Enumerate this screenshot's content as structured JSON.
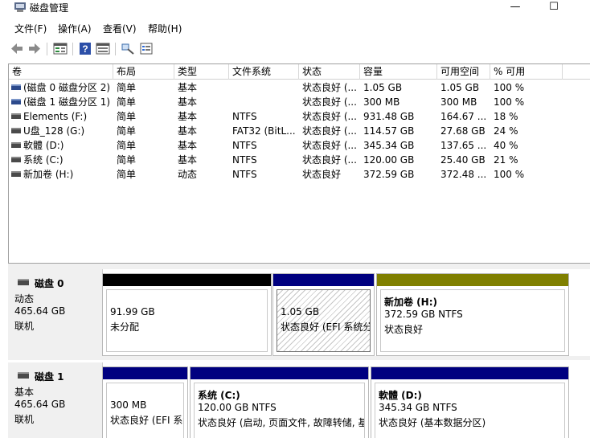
{
  "window": {
    "title": "磁盘管理",
    "minimize_glyph": "—",
    "maximize_glyph": "☐"
  },
  "menu": [
    {
      "label": "文件(F)"
    },
    {
      "label": "操作(A)"
    },
    {
      "label": "查看(V)"
    },
    {
      "label": "帮助(H)"
    }
  ],
  "toolbar": {
    "icons": [
      "back-arrow-icon",
      "forward-arrow-icon",
      "disk-list-icon",
      "help-icon",
      "properties-icon",
      "rescan-icon",
      "settings-list-icon"
    ]
  },
  "columns": [
    "卷",
    "布局",
    "类型",
    "文件系统",
    "状态",
    "容量",
    "可用空间",
    "% 可用"
  ],
  "volumes": [
    {
      "name": "(磁盘 0 磁盘分区 2)",
      "layout": "简单",
      "type": "基本",
      "fs": "",
      "status": "状态良好 (...",
      "capacity": "1.05 GB",
      "free": "1.05 GB",
      "pct": "100 %"
    },
    {
      "name": "(磁盘 1 磁盘分区 1)",
      "layout": "简单",
      "type": "基本",
      "fs": "",
      "status": "状态良好 (...",
      "capacity": "300 MB",
      "free": "300 MB",
      "pct": "100 %"
    },
    {
      "name": "Elements (F:)",
      "layout": "简单",
      "type": "基本",
      "fs": "NTFS",
      "status": "状态良好 (...",
      "capacity": "931.48 GB",
      "free": "164.67 ...",
      "pct": "18 %"
    },
    {
      "name": "U盘_128 (G:)",
      "layout": "简单",
      "type": "基本",
      "fs": "FAT32 (BitL...",
      "status": "状态良好 (...",
      "capacity": "114.57 GB",
      "free": "27.68 GB",
      "pct": "24 %"
    },
    {
      "name": "軟體 (D:)",
      "layout": "简单",
      "type": "基本",
      "fs": "NTFS",
      "status": "状态良好 (...",
      "capacity": "345.34 GB",
      "free": "137.65 ...",
      "pct": "40 %"
    },
    {
      "name": "系统 (C:)",
      "layout": "简单",
      "type": "基本",
      "fs": "NTFS",
      "status": "状态良好 (...",
      "capacity": "120.00 GB",
      "free": "25.40 GB",
      "pct": "21 %"
    },
    {
      "name": "新加卷 (H:)",
      "layout": "简单",
      "type": "动态",
      "fs": "NTFS",
      "status": "状态良好",
      "capacity": "372.59 GB",
      "free": "372.48 ...",
      "pct": "100 %"
    }
  ],
  "disks": [
    {
      "name": "磁盘 0",
      "kind": "动态",
      "size": "465.64 GB",
      "state": "联机",
      "partitions": [
        {
          "title": "",
          "line1": "91.99 GB",
          "line2": "未分配",
          "bar_color": "#000000"
        },
        {
          "title": "",
          "line1": "1.05 GB",
          "line2": "状态良好 (EFI 系统分",
          "bar_color": "#000080"
        },
        {
          "title": "新加卷  (H:)",
          "line1": "372.59 GB NTFS",
          "line2": "状态良好",
          "bar_color": "#808000"
        }
      ]
    },
    {
      "name": "磁盘 1",
      "kind": "基本",
      "size": "465.64 GB",
      "state": "联机",
      "partitions": [
        {
          "title": "",
          "line1": "300 MB",
          "line2": "状态良好 (EFI 系统",
          "bar_color": "#000080"
        },
        {
          "title": "系统  (C:)",
          "line1": "120.00 GB NTFS",
          "line2": "状态良好 (启动, 页面文件, 故障转储, 基",
          "bar_color": "#000080"
        },
        {
          "title": "軟體  (D:)",
          "line1": "345.34 GB NTFS",
          "line2": "状态良好 (基本数据分区)",
          "bar_color": "#000080"
        }
      ]
    }
  ]
}
